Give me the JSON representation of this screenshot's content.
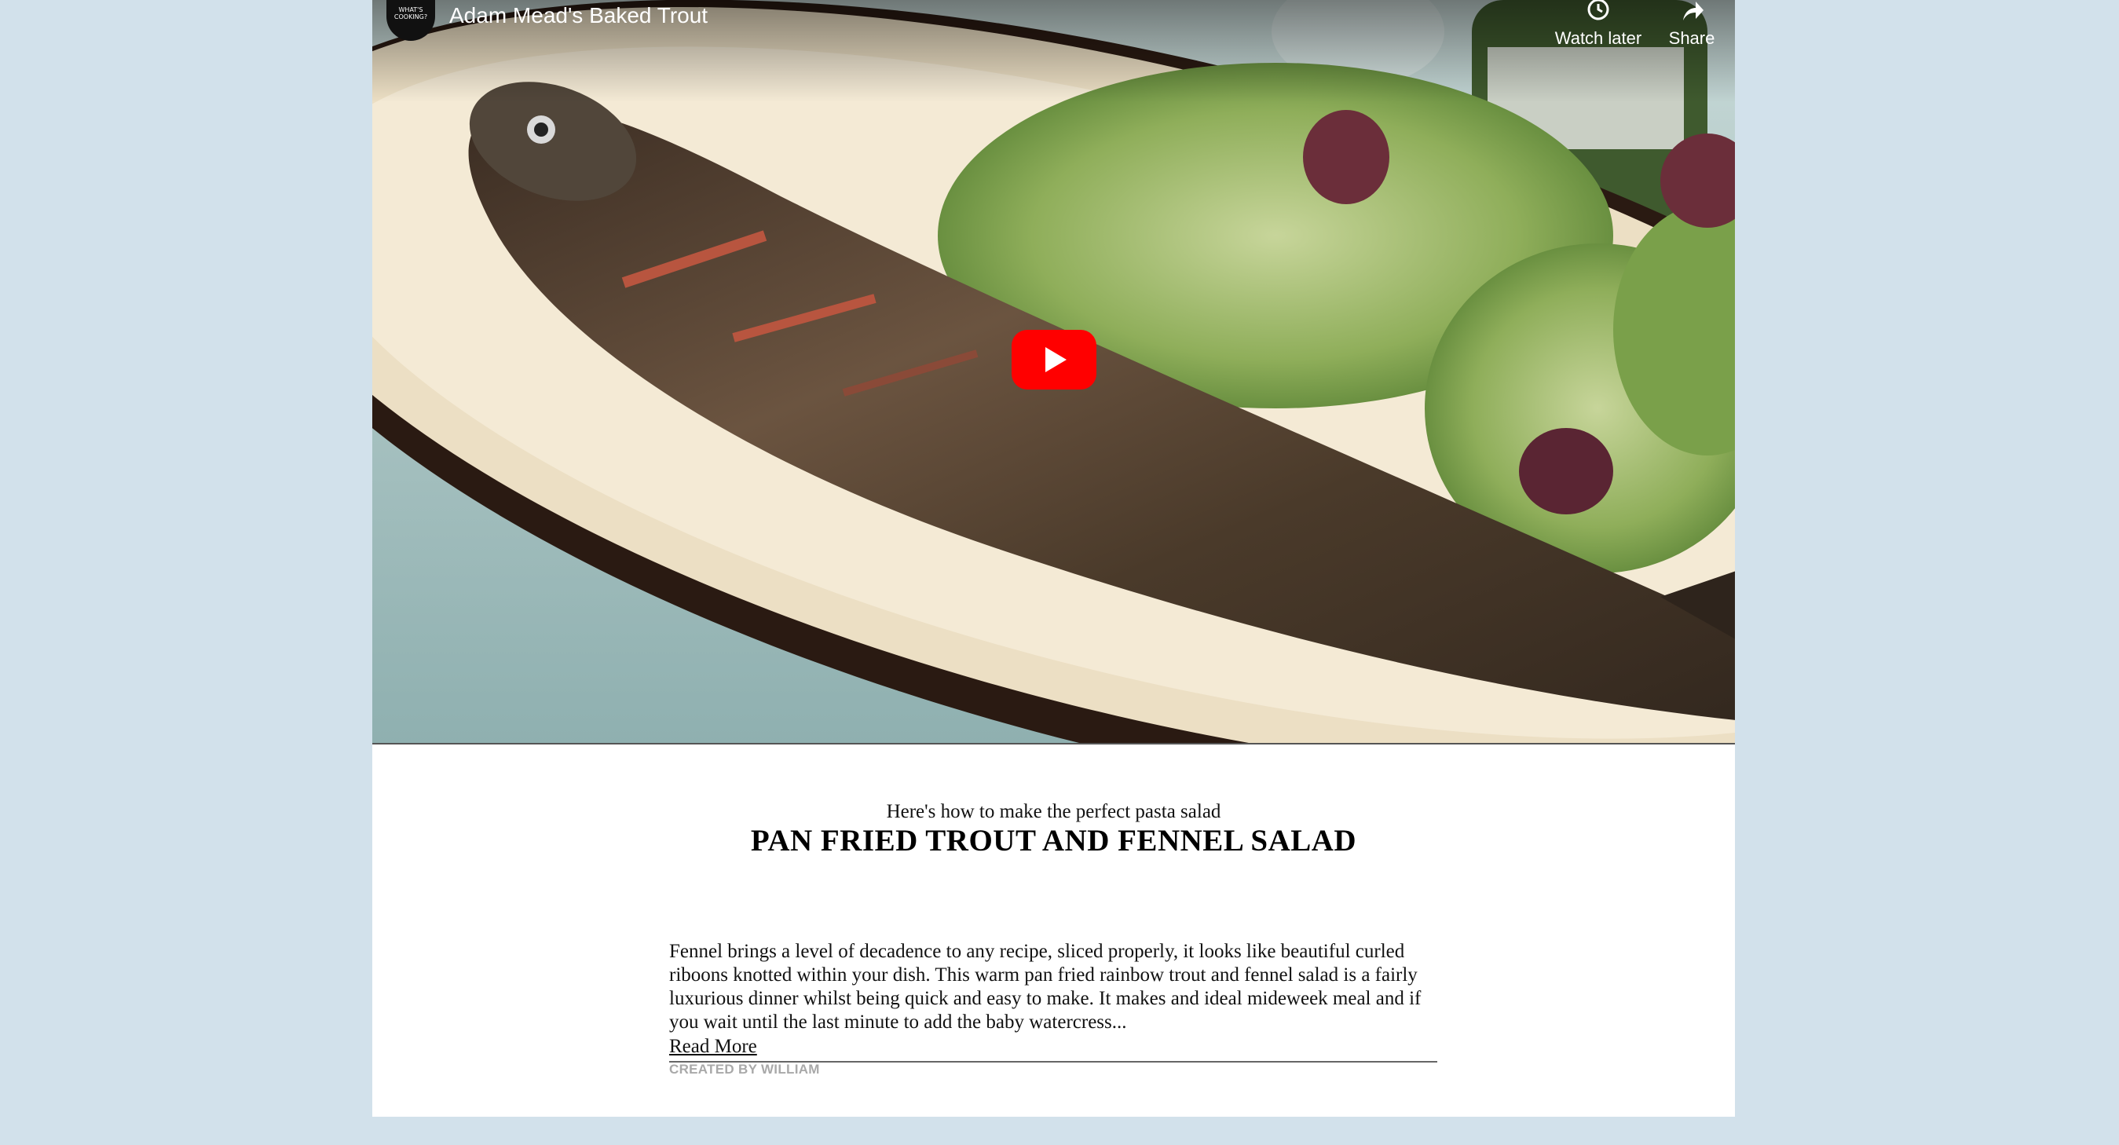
{
  "video": {
    "channel_logo_text": "WHAT'S COOKING?",
    "title": "Adam Mead's Baked Trout",
    "actions": {
      "watch_later": "Watch later",
      "share": "Share"
    },
    "play_icon": "youtube-play-icon"
  },
  "article": {
    "subtitle": "Here's how to make the perfect pasta salad",
    "title": "PAN FRIED TROUT AND FENNEL SALAD",
    "body": "Fennel brings a level of decadence to any recipe, sliced properly, it looks like beautiful curled riboons knotted within your dish. This warm pan fried rainbow trout and fennel salad is a fairly luxurious dinner whilst being quick and easy to make. It makes and ideal mideweek meal and if you wait until the last minute to add the baby watercress...",
    "read_more": "Read More",
    "credit": "CREATED BY WILLIAM"
  },
  "colors": {
    "page_background": "#d2e1eb",
    "card_background": "#ffffff",
    "play_red": "#ff0000",
    "credit_gray": "#a9a9a9"
  }
}
